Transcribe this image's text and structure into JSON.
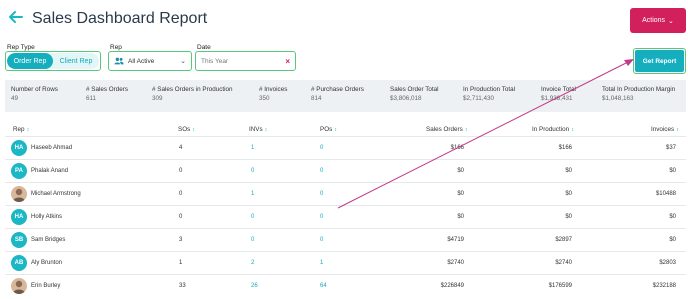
{
  "page": {
    "title": "Sales Dashboard Report",
    "actions_label": "Actions"
  },
  "filters": {
    "rep_type_label": "Rep Type",
    "rep_type_options": [
      "Order Rep",
      "Client Rep"
    ],
    "rep_label": "Rep",
    "rep_value": "All Active",
    "date_label": "Date",
    "date_value": "This Year",
    "get_report_label": "Get Report"
  },
  "stats": [
    {
      "label": "Number of Rows",
      "value": "49"
    },
    {
      "label": "# Sales Orders",
      "value": "611"
    },
    {
      "label": "# Sales Orders in Production",
      "value": "309"
    },
    {
      "label": "# Invoices",
      "value": "350"
    },
    {
      "label": "# Purchase Orders",
      "value": "814"
    },
    {
      "label": "Sales Order Total",
      "value": "$3,806,018"
    },
    {
      "label": "In Production Total",
      "value": "$2,711,430"
    },
    {
      "label": "Invoice Total",
      "value": "$1,938,431"
    },
    {
      "label": "Total In Production Margin",
      "value": "$1,048,163"
    }
  ],
  "table": {
    "headers": [
      "Rep",
      "SOs",
      "INVs",
      "POs",
      "Sales Orders",
      "In Production",
      "Invoices"
    ],
    "rows": [
      {
        "initials": "HA",
        "name": "Haseeb Ahmad",
        "sos": "4",
        "invs": "1",
        "pos": "0",
        "sales_orders": "$166",
        "in_production": "$166",
        "invoices": "$37"
      },
      {
        "initials": "PA",
        "name": "Phalak Anand",
        "sos": "0",
        "invs": "0",
        "pos": "0",
        "sales_orders": "$0",
        "in_production": "$0",
        "invoices": "$0"
      },
      {
        "initials": "",
        "name": "Michael Armstrong",
        "sos": "0",
        "invs": "1",
        "pos": "0",
        "sales_orders": "$0",
        "in_production": "$0",
        "invoices": "$10488"
      },
      {
        "initials": "HA",
        "name": "Holly Atkins",
        "sos": "0",
        "invs": "0",
        "pos": "0",
        "sales_orders": "$0",
        "in_production": "$0",
        "invoices": "$0"
      },
      {
        "initials": "SB",
        "name": "Sam Bridges",
        "sos": "3",
        "invs": "0",
        "pos": "0",
        "sales_orders": "$4719",
        "in_production": "$2897",
        "invoices": "$0"
      },
      {
        "initials": "AB",
        "name": "Aly Brunton",
        "sos": "1",
        "invs": "2",
        "pos": "1",
        "sales_orders": "$2740",
        "in_production": "$2740",
        "invoices": "$2803"
      },
      {
        "initials": "",
        "name": "Erin Burley",
        "sos": "33",
        "invs": "26",
        "pos": "64",
        "sales_orders": "$226849",
        "in_production": "$176599",
        "invoices": "$232188"
      }
    ]
  },
  "colors": {
    "accent": "#15aebf",
    "actions": "#d1205c",
    "highlight_border": "#57c87a",
    "annotation_arrow": "#c23a8a"
  }
}
